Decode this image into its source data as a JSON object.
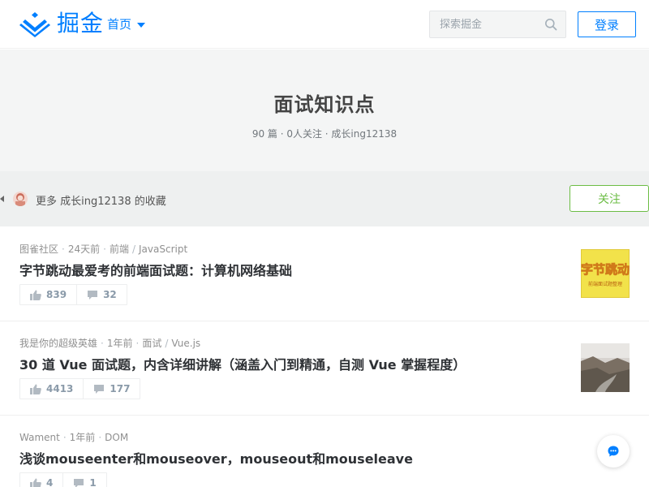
{
  "header": {
    "brand_name": "掘金",
    "nav_home_label": "首页",
    "search_placeholder": "探索掘金",
    "login_label": "登录",
    "brand_color": "#007fff"
  },
  "collection": {
    "title": "面试知识点",
    "stats": "90 篇 · 0人关注 · 成长ing12138",
    "owner_text": "更多 成长ing12138 的收藏",
    "follow_label": "关注",
    "follow_color": "#6cbd45"
  },
  "articles": [
    {
      "author": "图雀社区",
      "time": "24天前",
      "category": "前端",
      "tag": "JavaScript",
      "title": "字节跳动最爱考的前端面试题：计算机网络基础",
      "likes": "839",
      "comments": "32",
      "thumb_text": "字节跳动",
      "thumb_sub": "前端面试题整理"
    },
    {
      "author": "我是你的超级英雄",
      "time": "1年前",
      "category": "面试",
      "tag": "Vue.js",
      "title": "30 道 Vue 面试题，内含详细讲解（涵盖入门到精通，自测 Vue 掌握程度）",
      "likes": "4413",
      "comments": "177"
    },
    {
      "author": "Wament",
      "time": "1年前",
      "tag": "DOM",
      "title": "浅谈mouseenter和mouseover，mouseout和mouseleave",
      "likes": "4",
      "comments": "1"
    }
  ],
  "icons": {
    "logo": "juejin-logo-icon",
    "search": "search-icon",
    "like": "thumbs-up-icon",
    "comment": "comment-icon",
    "chat": "chat-bubble-icon"
  }
}
